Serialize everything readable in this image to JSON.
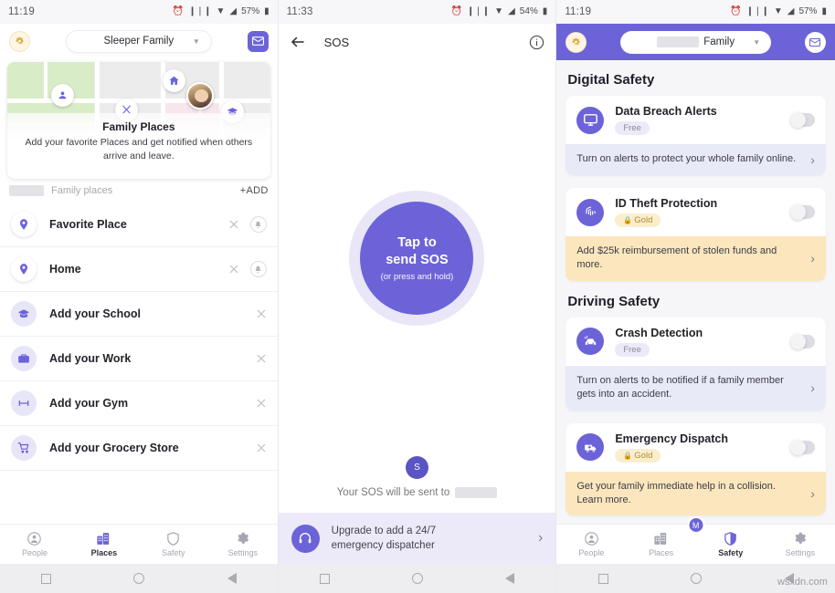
{
  "left": {
    "status": {
      "time": "11:19",
      "battery": "57%"
    },
    "header": {
      "badge_icon": "gold-star-badge-icon",
      "family_name": "Sleeper Family",
      "mail_icon": "mail-icon"
    },
    "map_card": {
      "title": "Family Places",
      "subtitle": "Add your favorite Places and get notified when others arrive and leave.",
      "markers": [
        "person-pin-icon",
        "home-icon",
        "restaurant-icon",
        "member-photo-pin",
        "school-icon"
      ]
    },
    "places_bar": {
      "label": "Family places",
      "add_label": "+ADD",
      "redacted": true
    },
    "places": [
      {
        "label": "Favorite Place",
        "icon": "location-pin-icon",
        "style": "white",
        "has_bell": true
      },
      {
        "label": "Home",
        "icon": "location-pin-icon",
        "style": "white",
        "has_bell": true
      },
      {
        "label": "Add your School",
        "icon": "school-icon",
        "style": "lavender",
        "has_bell": false
      },
      {
        "label": "Add your Work",
        "icon": "briefcase-icon",
        "style": "lavender",
        "has_bell": false
      },
      {
        "label": "Add your Gym",
        "icon": "dumbbell-icon",
        "style": "lavender",
        "has_bell": false
      },
      {
        "label": "Add your Grocery Store",
        "icon": "shopping-cart-icon",
        "style": "lavender",
        "has_bell": false
      }
    ],
    "tabs": [
      {
        "label": "People",
        "icon": "person-circle-icon",
        "active": false
      },
      {
        "label": "Places",
        "icon": "buildings-icon",
        "active": true
      },
      {
        "label": "Safety",
        "icon": "shield-icon",
        "active": false
      },
      {
        "label": "Settings",
        "icon": "gear-icon",
        "active": false
      }
    ]
  },
  "middle": {
    "status": {
      "time": "11:33",
      "battery": "54%"
    },
    "header": {
      "back_icon": "back-arrow-icon",
      "title": "SOS",
      "info_icon": "info-icon"
    },
    "sos_button": {
      "line1": "Tap to",
      "line2": "send SOS",
      "hint": "(or press and hold)"
    },
    "footer": {
      "avatar_initial": "S",
      "sent_to_text": "Your SOS will be sent to",
      "recipient_redacted": true
    },
    "upgrade": {
      "icon": "headset-icon",
      "line1": "Upgrade to add a 24/7",
      "line2": "emergency dispatcher",
      "chevron": "chevron-right-icon"
    }
  },
  "right": {
    "status": {
      "time": "11:19",
      "battery": "57%"
    },
    "header": {
      "badge_icon": "gold-star-badge-icon",
      "family_name": "Family",
      "family_name_redacted": true,
      "mail_icon": "mail-icon"
    },
    "sections": [
      {
        "title": "Digital Safety",
        "cards": [
          {
            "name": "Data Breach Alerts",
            "icon": "monitor-icon",
            "pill": {
              "text": "Free",
              "type": "free"
            },
            "toggle_on": false,
            "footer_text": "Turn on alerts to protect your whole family online.",
            "footer_style": "blue"
          },
          {
            "name": "ID Theft Protection",
            "icon": "fingerprint-icon",
            "pill": {
              "text": "Gold",
              "type": "gold"
            },
            "toggle_on": false,
            "footer_text": "Add $25k reimbursement of stolen funds and more.",
            "footer_style": "amber"
          }
        ]
      },
      {
        "title": "Driving Safety",
        "cards": [
          {
            "name": "Crash Detection",
            "icon": "crash-car-icon",
            "pill": {
              "text": "Free",
              "type": "free"
            },
            "toggle_on": false,
            "footer_text": "Turn on alerts to be notified if a family member gets into an accident.",
            "footer_style": "blue"
          },
          {
            "name": "Emergency Dispatch",
            "icon": "ambulance-icon",
            "pill": {
              "text": "Gold",
              "type": "gold"
            },
            "toggle_on": false,
            "footer_text": "Get your family immediate help in a collision. Learn more.",
            "footer_style": "amber"
          }
        ]
      }
    ],
    "avatar_badge": "M",
    "tabs": [
      {
        "label": "People",
        "icon": "person-circle-icon",
        "active": false
      },
      {
        "label": "Places",
        "icon": "buildings-icon",
        "active": false
      },
      {
        "label": "Safety",
        "icon": "shield-icon",
        "active": true
      },
      {
        "label": "Settings",
        "icon": "gear-icon",
        "active": false
      }
    ]
  },
  "watermark": "wsxdn.com",
  "colors": {
    "purple": "#6c63d9",
    "lavender": "#e7e5f8",
    "gold": "#b08b35",
    "amber_bg": "#fbe6bd",
    "blue_bg": "#e9eaf8"
  }
}
